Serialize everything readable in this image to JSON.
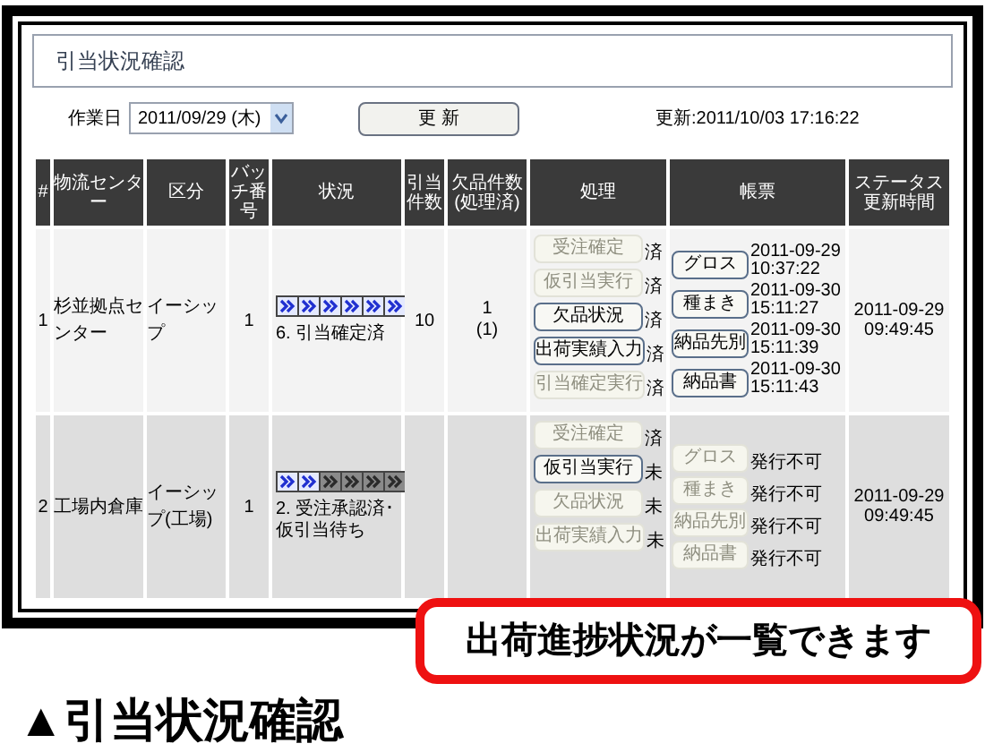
{
  "page_title": "引当状況確認",
  "work_date": {
    "label": "作業日",
    "value": "2011/09/29 (木)"
  },
  "refresh_button": "更 新",
  "updated": "更新:2011/10/03 17:16:22",
  "table": {
    "columns": [
      "#",
      "物流センター",
      "区分",
      "バッチ番号",
      "状況",
      "引当件数",
      "欠品件数(処理済)",
      "処理",
      "帳票",
      "ステータス更新時間"
    ],
    "rows": [
      {
        "no": "1",
        "center": "杉並拠点センター",
        "category": "イーシップ",
        "batch": "1",
        "stages": [
          {
            "done": true
          },
          {
            "done": true
          },
          {
            "done": true
          },
          {
            "done": true
          },
          {
            "done": true
          },
          {
            "done": true
          }
        ],
        "status": "6. 引当確定済",
        "allocated": "10",
        "shortage": "1",
        "shortage_processed": "(1)",
        "actions": [
          {
            "label": "受注確定",
            "disabled": true,
            "mark": "済"
          },
          {
            "label": "仮引当実行",
            "disabled": true,
            "mark": "済"
          },
          {
            "label": "欠品状況",
            "disabled": false,
            "mark": "済"
          },
          {
            "label": "出荷実績入力",
            "disabled": false,
            "mark": "済"
          },
          {
            "label": "引当確定実行",
            "disabled": true,
            "mark": "済"
          }
        ],
        "forms": [
          {
            "label": "グロス",
            "disabled": false,
            "issued": "2011-09-29 10:37:22"
          },
          {
            "label": "種まき",
            "disabled": false,
            "issued": "2011-09-30 15:11:27"
          },
          {
            "label": "納品先別",
            "disabled": false,
            "issued": "2011-09-30 15:11:39"
          },
          {
            "label": "納品書",
            "disabled": false,
            "issued": "2011-09-30 15:11:43"
          }
        ],
        "status_time": "2011-09-29 09:49:45"
      },
      {
        "no": "2",
        "center": "工場内倉庫",
        "category": "イーシップ(工場)",
        "batch": "1",
        "stages": [
          {
            "done": true
          },
          {
            "done": true
          },
          {
            "done": false
          },
          {
            "done": false
          },
          {
            "done": false
          },
          {
            "done": false
          }
        ],
        "status": "2. 受注承認済･仮引当待ち",
        "actions": [
          {
            "label": "受注確定",
            "disabled": true,
            "mark": "済"
          },
          {
            "label": "仮引当実行",
            "disabled": false,
            "mark": "未"
          },
          {
            "label": "欠品状況",
            "disabled": true,
            "mark": "未"
          },
          {
            "label": "出荷実績入力",
            "disabled": true,
            "mark": "未"
          }
        ],
        "forms": [
          {
            "label": "グロス",
            "disabled": true,
            "issued": "発行不可"
          },
          {
            "label": "種まき",
            "disabled": true,
            "issued": "発行不可"
          },
          {
            "label": "納品先別",
            "disabled": true,
            "issued": "発行不可"
          },
          {
            "label": "納品書",
            "disabled": true,
            "issued": "発行不可"
          }
        ],
        "status_time": "2011-09-29 09:49:45"
      }
    ]
  },
  "callout": "出荷進捗状況が一覧できます",
  "caption": "▲引当状況確認"
}
